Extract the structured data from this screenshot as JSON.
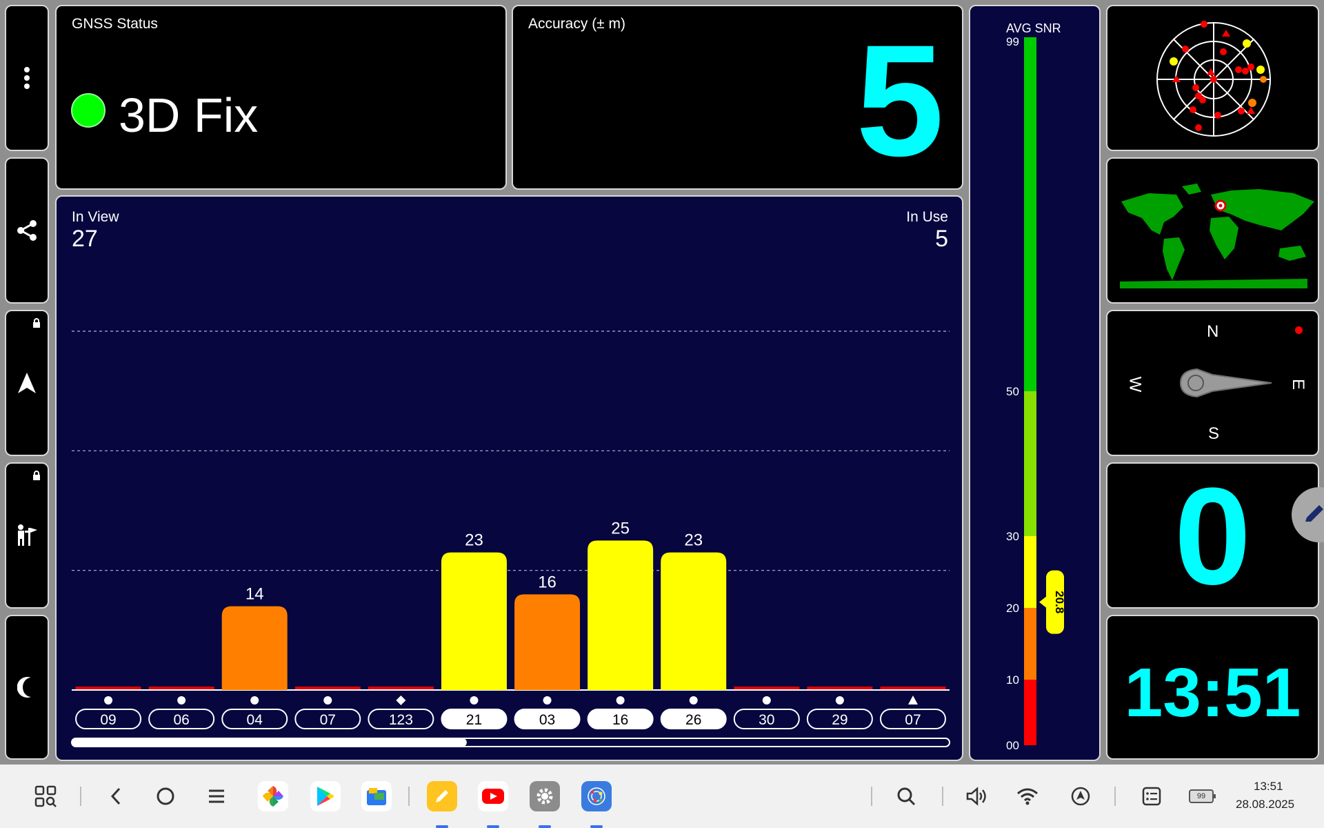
{
  "gnss_status": {
    "title": "GNSS Status",
    "value": "3D Fix",
    "indicator_color": "#00ff00"
  },
  "accuracy": {
    "title": "Accuracy (± m)",
    "value": "5"
  },
  "satellites": {
    "in_view_label": "In View",
    "in_view": "27",
    "in_use_label": "In Use",
    "in_use": "5"
  },
  "chart_data": {
    "type": "bar",
    "categories": [
      "09",
      "06",
      "04",
      "07",
      "123",
      "21",
      "03",
      "16",
      "26",
      "30",
      "29",
      "07"
    ],
    "values": [
      0,
      0,
      14,
      0,
      0,
      23,
      16,
      25,
      23,
      0,
      0,
      0
    ],
    "value_labels": [
      "",
      "",
      "14",
      "",
      "",
      "23",
      "16",
      "25",
      "23",
      "",
      "",
      ""
    ],
    "markers": [
      "circle",
      "circle",
      "circle",
      "circle",
      "diamond",
      "circle",
      "circle",
      "circle",
      "circle",
      "circle",
      "circle",
      "triangle"
    ],
    "in_use": [
      false,
      false,
      false,
      false,
      false,
      true,
      true,
      true,
      true,
      false,
      false,
      false
    ],
    "colors": [
      "#e00000",
      "#e00000",
      "#ff8000",
      "#e00000",
      "#e00000",
      "#ffff00",
      "#ff8000",
      "#ffff00",
      "#ffff00",
      "#e00000",
      "#e00000",
      "#e00000"
    ],
    "ylim": [
      0,
      60
    ],
    "gridlines": [
      20,
      40,
      60
    ],
    "scroll_fraction": 0.45
  },
  "snr": {
    "title": "AVG SNR",
    "ticks": [
      "99",
      "50",
      "30",
      "20",
      "10",
      "00"
    ],
    "avg": "20.8",
    "segments": [
      {
        "from": 0,
        "to": 10,
        "color": "#ff0000"
      },
      {
        "from": 10,
        "to": 20,
        "color": "#ff7a00"
      },
      {
        "from": 20,
        "to": 30,
        "color": "#ffff00"
      },
      {
        "from": 30,
        "to": 50,
        "color": "#88e000"
      },
      {
        "from": 50,
        "to": 99,
        "color": "#00cc00"
      }
    ]
  },
  "compass": {
    "n": "N",
    "s": "S",
    "e": "E",
    "w": "W"
  },
  "speed": {
    "value": "0"
  },
  "clock": {
    "value": "13:51"
  },
  "taskbar": {
    "time": "13:51",
    "date": "28.08.2025",
    "battery": "99"
  }
}
